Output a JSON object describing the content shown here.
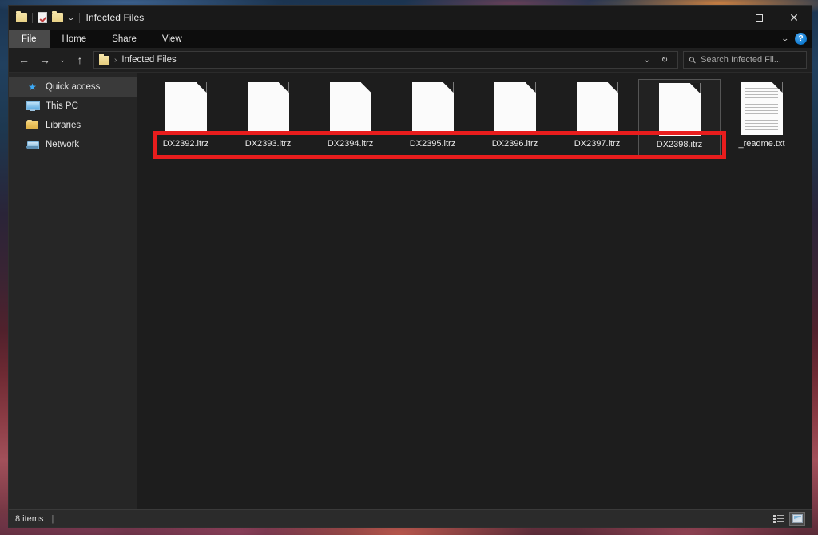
{
  "window": {
    "title": "Infected Files",
    "quick_access_icons": [
      "folder-icon",
      "properties-icon",
      "new-folder-icon",
      "qat-chevron-down-icon"
    ],
    "caption": {
      "minimize": "minimize-icon",
      "maximize": "maximize-icon",
      "close": "close-icon"
    }
  },
  "ribbon": {
    "tabs": [
      {
        "label": "File",
        "active": true
      },
      {
        "label": "Home",
        "active": false
      },
      {
        "label": "Share",
        "active": false
      },
      {
        "label": "View",
        "active": false
      }
    ],
    "collapse_icon": "chevron-down-icon",
    "help_label": "?"
  },
  "nav": {
    "back_icon": "←",
    "forward_icon": "→",
    "recent_icon": "⌄",
    "up_icon": "↑",
    "address": {
      "folder_icon": "folder-icon",
      "separator": "›",
      "path_text": "Infected Files",
      "dropdown_icon": "⌄",
      "refresh_icon": "↻"
    },
    "search": {
      "placeholder": "Search Infected Fil...",
      "icon": "search-icon"
    }
  },
  "sidebar": {
    "items": [
      {
        "label": "Quick access",
        "icon": "star-icon",
        "selected": true
      },
      {
        "label": "This PC",
        "icon": "monitor-icon",
        "selected": false
      },
      {
        "label": "Libraries",
        "icon": "libraries-folder-icon",
        "selected": false
      },
      {
        "label": "Network",
        "icon": "network-icon",
        "selected": false
      }
    ]
  },
  "files": [
    {
      "name": "DX2392.itrz",
      "type": "encrypted",
      "selected": false
    },
    {
      "name": "DX2393.itrz",
      "type": "encrypted",
      "selected": false
    },
    {
      "name": "DX2394.itrz",
      "type": "encrypted",
      "selected": false
    },
    {
      "name": "DX2395.itrz",
      "type": "encrypted",
      "selected": false
    },
    {
      "name": "DX2396.itrz",
      "type": "encrypted",
      "selected": false
    },
    {
      "name": "DX2397.itrz",
      "type": "encrypted",
      "selected": false
    },
    {
      "name": "DX2398.itrz",
      "type": "encrypted",
      "selected": true
    },
    {
      "name": "_readme.txt",
      "type": "text",
      "selected": false
    }
  ],
  "annotation": {
    "color": "#e81d1d",
    "shape": "rectangle",
    "covers": "DX2392.itrz through DX2398.itrz"
  },
  "status": {
    "item_count": "8 items",
    "separator": "|",
    "views": [
      {
        "name": "details-view-button",
        "active": false
      },
      {
        "name": "large-icons-view-button",
        "active": true
      }
    ]
  }
}
